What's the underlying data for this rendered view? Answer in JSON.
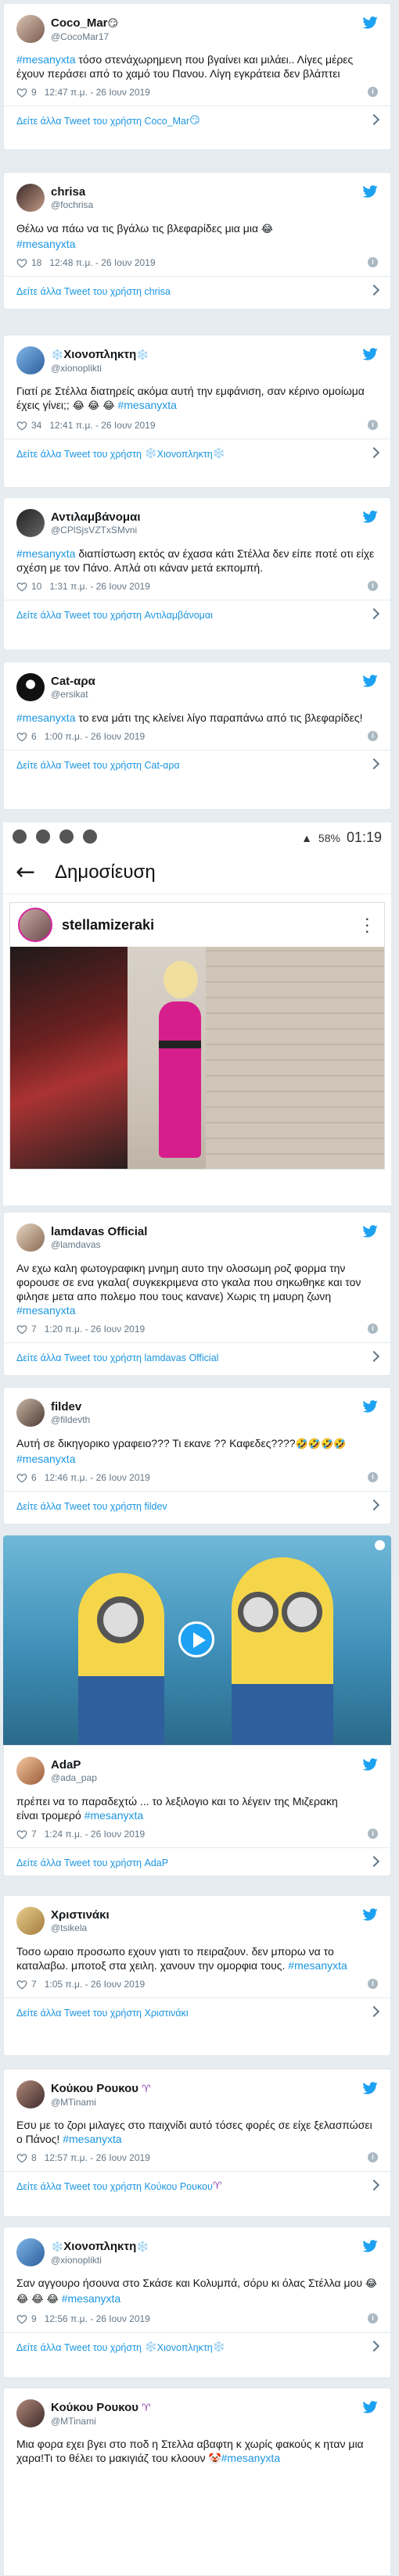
{
  "more_prefix": "Δείτε άλλα Tweet του χρήστη",
  "tweets": [
    {
      "name": "Coco_Mar",
      "name_emoji": "😏",
      "handle": "@CocoMar17",
      "text_tag": "#mesanyxta",
      "text": " τόσο στενάχωρημενη που βγαίνει και μιλάει.. Λίγες μέρες έχουν περάσει από το χαμό του Πανου. Λίγη εγκράτεια δεν βλάπτει",
      "likes": "9",
      "time": "12:47 π.μ. - 26 Ιουν 2019",
      "more_name": "Coco_Mar",
      "more_emoji": "😏"
    },
    {
      "name": "chrisa",
      "handle": "@fochrisa",
      "text_pre": "Θέλω να πάω να τις βγάλω τις βλεφαρίδες μια μια ",
      "text_emoji": "😂",
      "text_tag": "#mesanyxta",
      "likes": "18",
      "time": "12:48 π.μ. - 26 Ιουν 2019",
      "more_name": "chrisa"
    },
    {
      "name": "Χιονοπληκτη",
      "name_emoji": "❄️",
      "handle": "@xionoplikti",
      "text": "Γιατί ρε Στέλλα διατηρείς ακόμα αυτή την εμφάνιση, σαν κέρινο ομοίωμα έχεις γίνει;;",
      "text_emoji": "😂 😂 😂",
      "text_tag": "#mesanyxta",
      "likes": "34",
      "time": "12:41 π.μ. - 26 Ιουν 2019",
      "more_name": "Χιονοπληκτη",
      "more_emoji": "❄️"
    },
    {
      "name": "Αντιλαμβάνομαι",
      "handle": "@CPlSjsVZTxSMvni",
      "text_tag": "#mesanyxta",
      "text": " διαπίστωση εκτός αν έχασα κάτι Στέλλα δεν είπε ποτέ οτι είχε σχέση με τον Πάνο. Απλά οτι κάναν μετά εκπομπή.",
      "likes": "10",
      "time": "1:31 π.μ. - 26 Ιουν 2019",
      "more_name": "Αντιλαμβάνομαι"
    },
    {
      "name": "Cat-αρα",
      "handle": "@ersikat",
      "text_tag": "#mesanyxta",
      "text": " το ενα μάτι της κλείνει λίγο παραπάνω από τις βλεφαρίδες!",
      "likes": "6",
      "time": "1:00 π.μ. - 26 Ιουν 2019",
      "more_name": "Cat-αρα"
    },
    {
      "name": "lamdavas Official",
      "handle": "@lamdavas",
      "text": "Αν εχω καλη φωτογραφικη μνημη αυτο την ολοσωμη ροζ φορμα την φορουσε σε ενα γκαλα( συγκεκριμενα στο γκαλα που σηκωθηκε  και τον φιλησε μετα απο πολεμο που τους κανανε) Χωρις τη μαυρη ζωνη ",
      "text_tag": "#mesanyxta",
      "likes": "7",
      "time": "1:20 π.μ. - 26 Ιουν 2019",
      "more_name": "lamdavas Official"
    },
    {
      "name": "fildev",
      "handle": "@fildevth",
      "text": "Αυτή σε δικηγορικο γραφειο??? Τι εκανε ?? Καφεδες????",
      "text_emoji": "🤣🤣🤣🤣",
      "text_tag": "#mesanyxta",
      "likes": "6",
      "time": "12:46 π.μ. - 26 Ιουν 2019",
      "more_name": "fildev"
    },
    {
      "name": "AdaP",
      "handle": "@ada_pap",
      "text": "πρέπει να το παραδεχτώ ... το λεξιλογιο και το λέγειν της Μιζερακη\nείναι τρομερό ",
      "text_tag": "#mesanyxta",
      "likes": "7",
      "time": "1:24 π.μ. - 26 Ιουν 2019",
      "more_name": "AdaP"
    },
    {
      "name": "Χριστινάκι",
      "handle": "@tsikela",
      "text": "Τοσο ωραιο προσωπο εχουν  γιατι το πειραζουν.   δεν μπορω να το καταλαβω.  μποτοξ στα χειλη.  χανουν την ομορφια τους. ",
      "text_tag": "#mesanyxta",
      "likes": "7",
      "time": "1:05 π.μ. - 26 Ιουν 2019",
      "more_name": "Χριστινάκι"
    },
    {
      "name": "Κούκου Ρουκου",
      "name_emoji": "♈",
      "handle": "@MTinami",
      "text": "Εσυ με το ζορι μιλαγες στο παιχνίδι αυτό τόσες φορές σε είχε ξελασπώσει ο Πάνος! ",
      "text_tag": "#mesanyxta",
      "likes": "8",
      "time": "12:57 π.μ. - 26 Ιουν 2019",
      "more_name": "Κούκου Ρουκου",
      "more_emoji": "♈"
    },
    {
      "name": "Χιονοπληκτη",
      "name_emoji": "❄️",
      "handle": "@xionoplikti",
      "text": "Σαν αγγουρο ήσουνα στο Σκάσε και Κολυμπά, σόρυ κι όλας Στέλλα μου ",
      "text_emoji": "😂 😂 😂 😂",
      "text_tag": "#mesanyxta",
      "likes": "9",
      "time": "12:56 π.μ. - 26 Ιουν 2019",
      "more_name": "Χιονοπληκτη",
      "more_emoji": "❄️"
    },
    {
      "name": "Κούκου Ρουκου",
      "name_emoji": "♈",
      "handle": "@MTinami",
      "text": "Μια φορα εχει βγει στο ποδ η Στελλα αβαφτη κ χωρίς φακούς κ ηταν μια χαρα!Τι το θέλει το μακιγιάζ του κλοουν ",
      "text_emoji": "🤡",
      "text_tag": "#mesanyxta",
      "likes": "",
      "time": "",
      "more_name": ""
    }
  ],
  "phone": {
    "status_time": "01:19",
    "battery": "58%",
    "title": "Δημοσίευση",
    "ig_user": "stellamizeraki"
  },
  "icons": {
    "bird": "twitter-bird-icon",
    "heart": "heart-icon",
    "info": "info-icon",
    "chevron": "chevron-right-icon"
  },
  "colors": {
    "link": "#1b95e0",
    "twitter": "#1da1f2",
    "background": "#e6ecf0"
  }
}
